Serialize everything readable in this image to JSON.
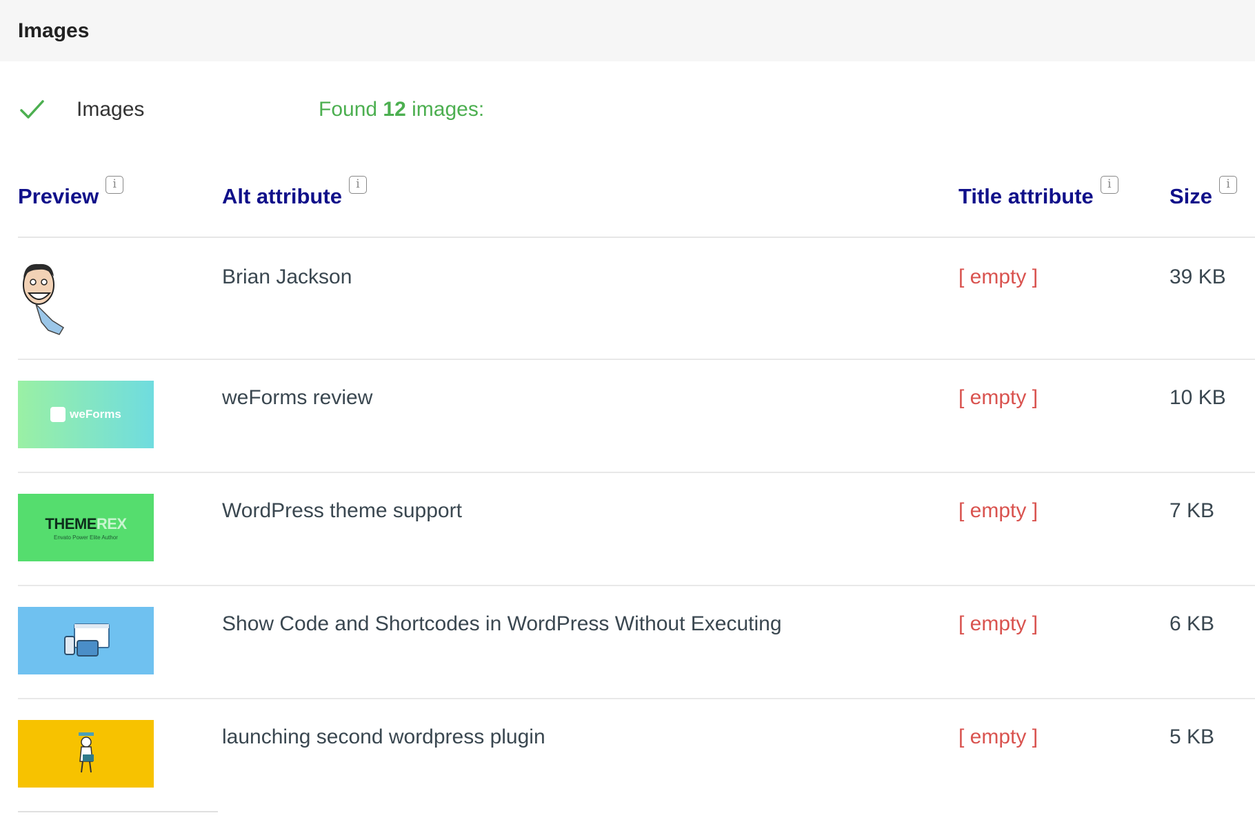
{
  "section": {
    "title": "Images"
  },
  "summary": {
    "label": "Images",
    "found_prefix": "Found",
    "found_count": "12",
    "found_suffix": "images:",
    "status": "pass",
    "status_color": "#4caf50"
  },
  "table": {
    "headers": {
      "preview": "Preview",
      "alt": "Alt attribute",
      "title": "Title attribute",
      "size": "Size",
      "info": "i"
    },
    "rows": [
      {
        "preview": "brian-jackson-avatar",
        "alt": "Brian Jackson",
        "title": "[ empty ]",
        "size": "39 KB"
      },
      {
        "preview": "weforms-thumbnail",
        "preview_text": "weForms",
        "alt": "weForms review",
        "title": "[ empty ]",
        "size": "10 KB"
      },
      {
        "preview": "themerex-thumbnail",
        "preview_text": "THEME",
        "preview_text_accent": "REX",
        "preview_subtext": "Envato Power Elite Author",
        "alt": "WordPress theme support",
        "title": "[ empty ]",
        "size": "7 KB"
      },
      {
        "preview": "devices-thumbnail",
        "alt": "Show Code and Shortcodes in WordPress Without Executing",
        "title": "[ empty ]",
        "size": "6 KB"
      },
      {
        "preview": "launch-thumbnail",
        "alt": "launching second wordpress plugin",
        "title": "[ empty ]",
        "size": "5 KB"
      }
    ]
  },
  "colors": {
    "header_text": "#10108a",
    "empty_text": "#d9534f",
    "success": "#4caf50"
  }
}
